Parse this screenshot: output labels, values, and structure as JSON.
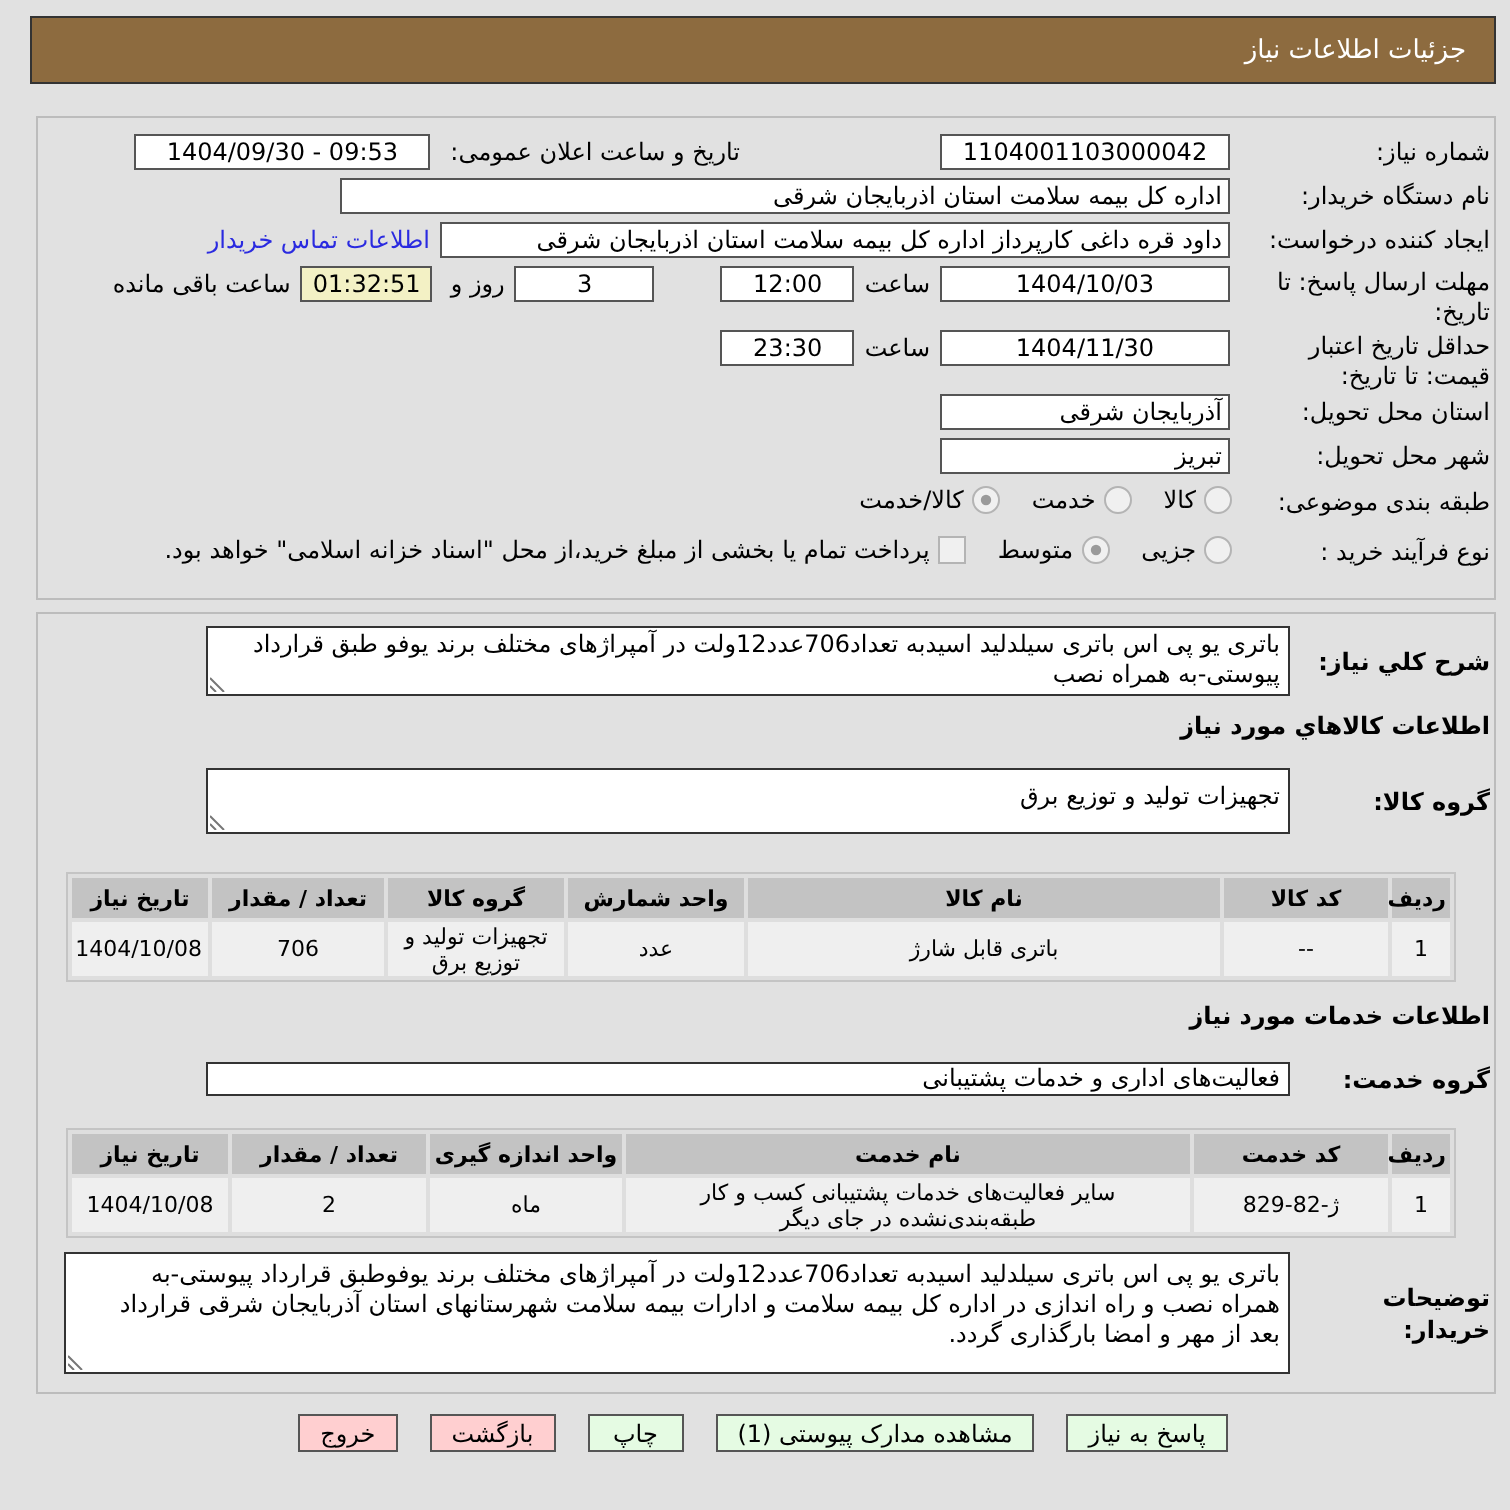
{
  "header": {
    "title": "جزئیات اطلاعات نیاز"
  },
  "details": {
    "need_number": {
      "label": "شماره نیاز:",
      "value": "1104001103000042"
    },
    "announce_datetime": {
      "label": "تاریخ و ساعت اعلان عمومی:",
      "value": "1404/09/30 - 09:53"
    },
    "buyer_org": {
      "label": "نام دستگاه خریدار:",
      "value": "اداره کل بیمه سلامت استان اذربایجان شرقی"
    },
    "requester": {
      "label": "ایجاد کننده درخواست:",
      "value": "داود قره داغی کارپرداز اداره کل بیمه سلامت استان اذربایجان شرقی",
      "link": "اطلاعات تماس خریدار"
    },
    "reply_deadline": {
      "label": "مهلت ارسال پاسخ: تا تاریخ:",
      "date": "1404/10/03",
      "time_label": "ساعت",
      "time": "12:00",
      "days": "3",
      "days_label": "روز و",
      "remaining": "01:32:51",
      "remaining_label": "ساعت باقی مانده"
    },
    "price_validity": {
      "label": "حداقل تاریخ اعتبار قیمت: تا تاریخ:",
      "date": "1404/11/30",
      "time_label": "ساعت",
      "time": "23:30"
    },
    "delivery_province": {
      "label": "استان محل تحویل:",
      "value": "آذربایجان شرقی"
    },
    "delivery_city": {
      "label": "شهر محل تحویل:",
      "value": "تبریز"
    },
    "subject_category": {
      "label": "طبقه بندی موضوعی:",
      "disabled": true,
      "options": [
        {
          "label": "کالا",
          "selected": false
        },
        {
          "label": "خدمت",
          "selected": false
        },
        {
          "label": "کالا/خدمت",
          "selected": true
        }
      ]
    },
    "purchase_process": {
      "label": "نوع فرآیند خرید :",
      "disabled": true,
      "options": [
        {
          "label": "جزیی",
          "selected": false
        },
        {
          "label": "متوسط",
          "selected": true
        }
      ],
      "payment_note": {
        "label": "پرداخت تمام یا بخشی از مبلغ خرید،از محل \"اسناد خزانه اسلامی\" خواهد بود.",
        "checked": false
      }
    }
  },
  "general_description": {
    "label": "شرح کلي نیاز:",
    "value": "باتری یو پی اس باتری سیلدلید اسیدبه تعداد706عدد12ولت در آمپراژهای مختلف برند یوفو طبق قرارداد پیوستی-به همراه نصب"
  },
  "goods": {
    "title": "اطلاعات کالاهاي مورد نیاز",
    "group": {
      "label": "گروه کالا:",
      "value": "تجهیزات تولید و توزیع برق"
    },
    "table": {
      "columns": [
        "ردیف",
        "کد کالا",
        "نام کالا",
        "واحد شمارش",
        "گروه کالا",
        "تعداد / مقدار",
        "تاریخ نیاز"
      ],
      "rows": [
        [
          "1",
          "--",
          "باتری قابل شارژ",
          "عدد",
          "تجهیزات تولید و توزیع برق",
          "706",
          "1404/10/08"
        ]
      ]
    }
  },
  "services": {
    "title": "اطلاعات خدمات مورد نیاز",
    "group": {
      "label": "گروه خدمت:",
      "value": "فعالیت‌های اداری و خدمات پشتیبانی"
    },
    "table": {
      "columns": [
        "ردیف",
        "کد خدمت",
        "نام خدمت",
        "واحد اندازه گیری",
        "تعداد / مقدار",
        "تاریخ نیاز"
      ],
      "rows": [
        [
          "1",
          "ژ-82-829",
          "سایر فعالیت‌های خدمات پشتیبانی کسب و کار طبقه‌بندی‌نشده در جای دیگر",
          "ماه",
          "2",
          "1404/10/08"
        ]
      ]
    }
  },
  "buyer_notes": {
    "label": "توضیحات خریدار:",
    "value": "باتری یو پی اس باتری سیلدلید اسیدبه تعداد706عدد12ولت در آمپراژهای مختلف برند یوفوطبق قرارداد پیوستی-به همراه نصب و راه اندازی در اداره کل بیمه سلامت و ادارات بیمه سلامت شهرستانهای استان آذربایجان شرقی قرارداد بعد از مهر و امضا بارگذاری گردد."
  },
  "buttons": [
    {
      "label": "پاسخ به نیاز",
      "kind": "action"
    },
    {
      "label": "مشاهده مدارک پیوستی (1)",
      "kind": "action"
    },
    {
      "label": "چاپ",
      "kind": "action"
    },
    {
      "label": "بازگشت",
      "kind": "exit"
    },
    {
      "label": "خروج",
      "kind": "exit"
    }
  ]
}
